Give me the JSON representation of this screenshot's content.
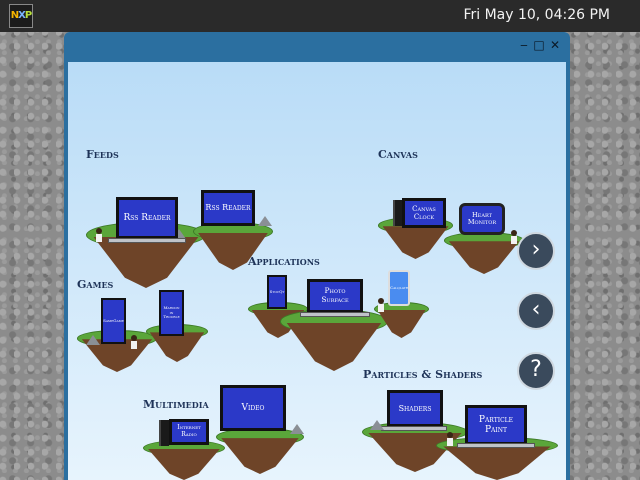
{
  "topbar": {
    "logo": {
      "n": "N",
      "x": "X",
      "p": "P"
    },
    "clock": "Fri May 10, 04:26 PM"
  },
  "window": {
    "controls": {
      "minimize": "‒",
      "maximize": "□",
      "close": "✕"
    }
  },
  "categories": {
    "feeds": "Feeds",
    "canvas": "Canvas",
    "applications": "Applications",
    "games": "Games",
    "multimedia": "Multimedia",
    "particles": "Particles & Shaders"
  },
  "demos": {
    "rss_reader_1": "Rss Reader",
    "rss_reader_2": "Rss Reader",
    "canvas_clock": "Canvas Clock",
    "heart_monitor": "Heart Monitor",
    "samegame": "SameGame",
    "maroon": "Maroon in Trouble",
    "photo_surface": "Photo Surface",
    "stocqt": "StocQt",
    "calqlatr": "Calqlatr",
    "video": "Video",
    "internet_radio": "Internet Radio",
    "shaders": "Shaders",
    "particle_paint": "Particle Paint"
  },
  "nav": {
    "next": "›",
    "prev": "‹",
    "help": "?"
  }
}
